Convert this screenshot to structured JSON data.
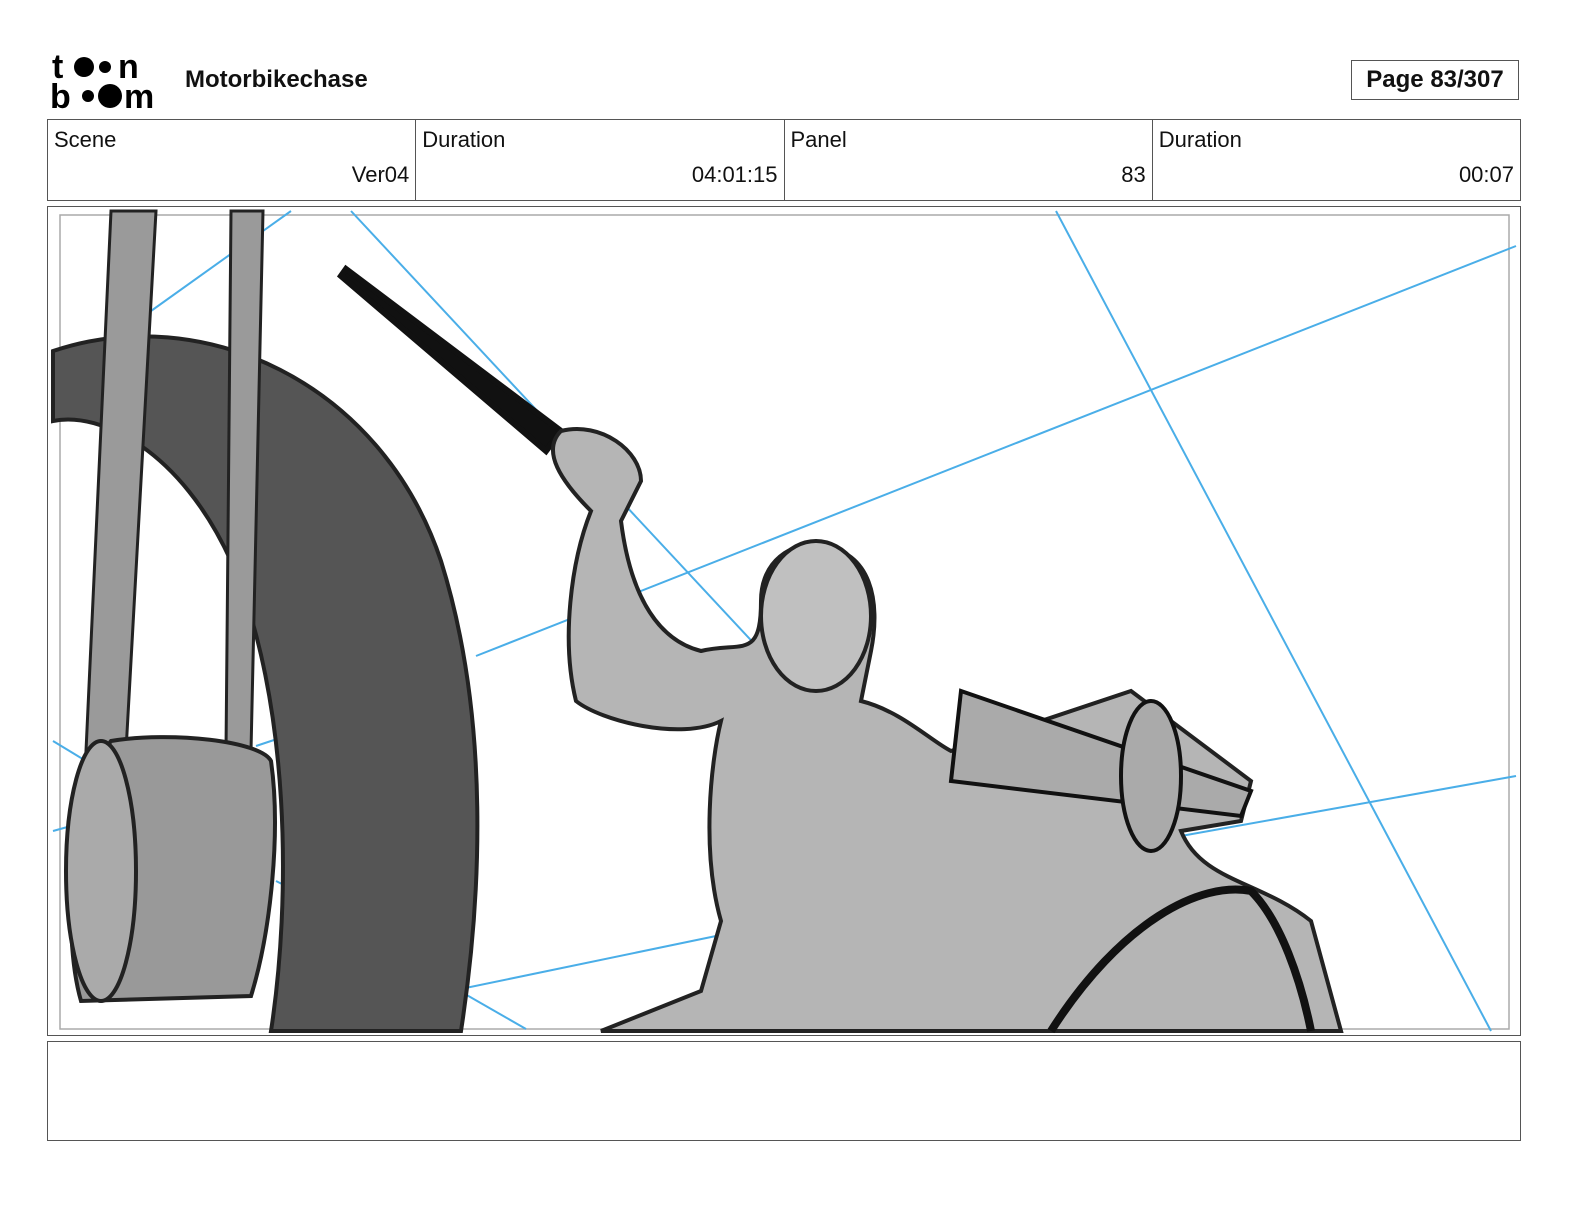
{
  "header": {
    "logo_text": "toon boom",
    "project_title": "Motorbikechase",
    "page_label": "Page  83/307"
  },
  "info": [
    {
      "label": "Scene",
      "value": "Ver04"
    },
    {
      "label": "Duration",
      "value": "04:01:15"
    },
    {
      "label": "Panel",
      "value": "83"
    },
    {
      "label": "Duration",
      "value": "00:07"
    }
  ],
  "panel": {
    "guide_color": "#4aaee8",
    "notes": ""
  }
}
